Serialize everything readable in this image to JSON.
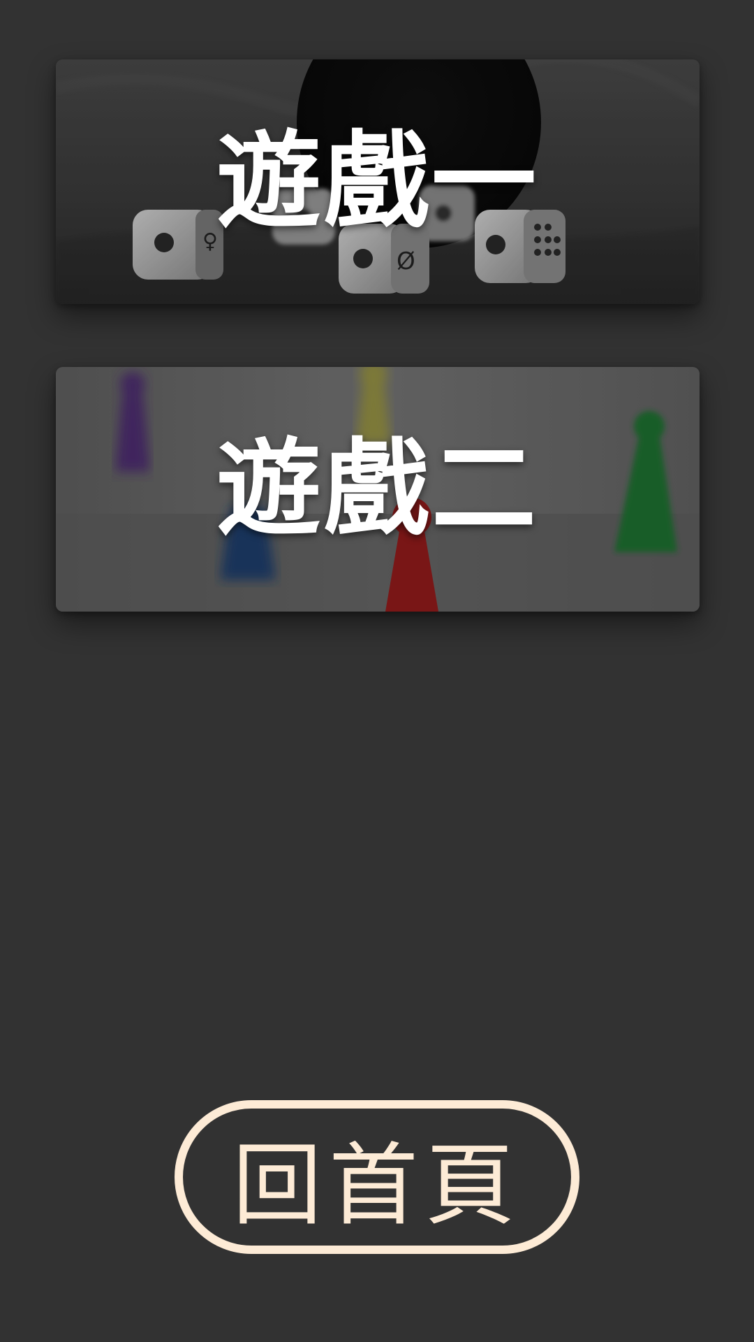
{
  "games": [
    {
      "title": "遊戲一",
      "image": "dice-photo"
    },
    {
      "title": "遊戲二",
      "image": "game-pawns-photo"
    }
  ],
  "home_button": {
    "label": "回首頁"
  },
  "colors": {
    "background": "#323232",
    "card_text": "#ffffff",
    "home_accent": "#fdebd6"
  }
}
